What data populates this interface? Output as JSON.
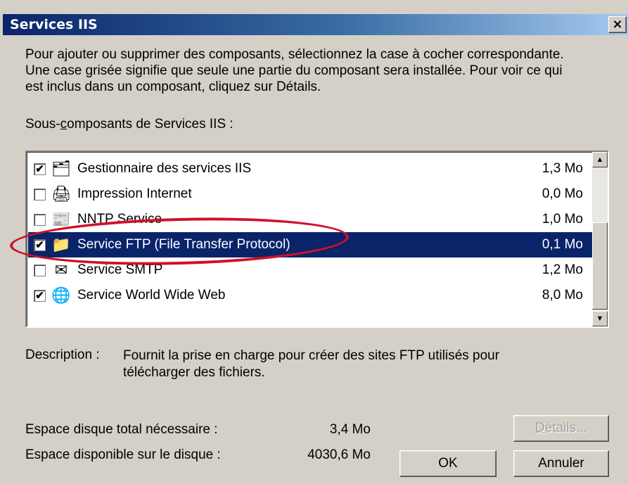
{
  "window": {
    "title": "Services IIS",
    "close_label": "×"
  },
  "intro": "Pour ajouter ou supprimer des composants, sélectionnez la case à cocher correspondante. Une case grisée signifie que seule une partie du composant sera installée. Pour voir ce qui est inclus dans un composant, cliquez sur Détails.",
  "subcomponents_label_pre": "Sous-",
  "subcomponents_label_accel": "c",
  "subcomponents_label_post": "omposants de Services IIS :",
  "components": [
    {
      "name": "Gestionnaire des services IIS",
      "size": "1,3 Mo",
      "checked": true,
      "icon": "iis-manager-icon"
    },
    {
      "name": "Impression Internet",
      "size": "0,0 Mo",
      "checked": false,
      "icon": "printer-icon"
    },
    {
      "name": "NNTP Service",
      "size": "1,0 Mo",
      "checked": false,
      "icon": "nntp-icon"
    },
    {
      "name": "Service FTP (File Transfer Protocol)",
      "size": "0,1 Mo",
      "checked": true,
      "icon": "folder-icon",
      "selected": true
    },
    {
      "name": "Service SMTP",
      "size": "1,2 Mo",
      "checked": false,
      "icon": "mail-icon"
    },
    {
      "name": "Service World Wide Web",
      "size": "8,0 Mo",
      "checked": true,
      "icon": "globe-icon"
    }
  ],
  "description": {
    "label": "Description :",
    "text": "Fournit la prise en charge pour créer des sites FTP utilisés pour télécharger des fichiers."
  },
  "disk": {
    "required_label": "Espace disque total nécessaire :",
    "required_value": "3,4 Mo",
    "available_label": "Espace disponible sur le disque :",
    "available_value": "4030,6 Mo"
  },
  "buttons": {
    "details_accel": "D",
    "details_rest": "étails...",
    "ok": "OK",
    "cancel": "Annuler"
  },
  "colors": {
    "selection": "#0a246a",
    "highlight_ellipse": "#d0102a",
    "dialog_bg": "#d4d0c8"
  }
}
